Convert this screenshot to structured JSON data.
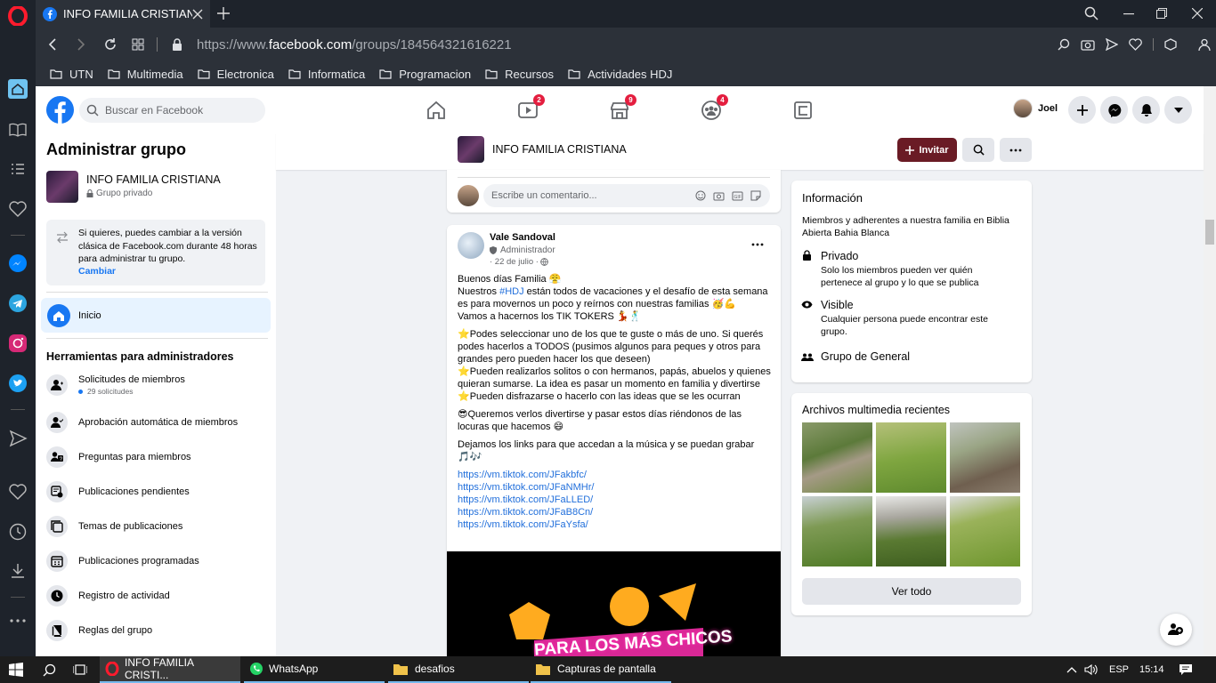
{
  "browser": {
    "tab_title": "INFO FAMILIA CRISTIANA |",
    "url_prefix": "https://www.",
    "url_domain": "facebook.com",
    "url_path": "/groups/184564321616221",
    "bookmarks": [
      "UTN",
      "Multimedia",
      "Electronica",
      "Informatica",
      "Programacion",
      "Recursos",
      "Actividades HDJ"
    ]
  },
  "fb_header": {
    "search_placeholder": "Buscar en Facebook",
    "badges": {
      "watch": "2",
      "marketplace": "9",
      "groups": "4"
    },
    "user_name": "Joel"
  },
  "left_panel": {
    "title": "Administrar grupo",
    "group_name": "INFO FAMILIA CRISTIANA",
    "privacy": "Grupo privado",
    "notice": "Si quieres, puedes cambiar a la versión clásica de Facebook.com durante 48 horas para administrar tu grupo.",
    "notice_link": "Cambiar",
    "home": "Inicio",
    "tools_title": "Herramientas para administradores",
    "tools": [
      {
        "label": "Solicitudes de miembros",
        "sub": "29 solicitudes"
      },
      {
        "label": "Aprobación automática de miembros"
      },
      {
        "label": "Preguntas para miembros"
      },
      {
        "label": "Publicaciones pendientes"
      },
      {
        "label": "Temas de publicaciones"
      },
      {
        "label": "Publicaciones programadas"
      },
      {
        "label": "Registro de actividad"
      },
      {
        "label": "Reglas del grupo"
      }
    ]
  },
  "group_header": {
    "name": "INFO FAMILIA CRISTIANA",
    "invite": "Invitar"
  },
  "comment_placeholder": "Escribe un comentario...",
  "post": {
    "author": "Vale Sandoval",
    "role": "Administrador",
    "date": "· 22 de julio ·",
    "p1": "Buenos días Familia 😤",
    "p2a": "Nuestros ",
    "hashtag": "#HDJ",
    "p2b": " están todos de vacaciones y el desafío de esta semana es para movernos un poco y reírnos con nuestras familias 🥳💪",
    "p3": "Vamos a hacernos los TIK TOKERS 💃🕺",
    "p4": "⭐Podes seleccionar uno de los que te guste o más de uno. Si querés podes hacerlos a TODOS (pusimos algunos para peques y otros para grandes pero pueden hacer los que deseen)",
    "p5": "⭐Pueden realizarlos solitos o con hermanos, papás, abuelos y quienes quieran sumarse. La idea es pasar un momento en familia y divertirse",
    "p6": "⭐Pueden disfrazarse o hacerlo con las ideas que se les ocurran",
    "p7": "😎Queremos verlos divertirse y pasar estos días riéndonos de las locuras que hacemos 😄",
    "p8": "Dejamos los links para que accedan a la música y se puedan grabar 🎵🎶",
    "links": [
      "https://vm.tiktok.com/JFakbfc/",
      "https://vm.tiktok.com/JFaNMHr/",
      "https://vm.tiktok.com/JFaLLED/",
      "https://vm.tiktok.com/JFaB8Cn/",
      "https://vm.tiktok.com/JFaYsfa/"
    ],
    "image_text": "PARA LOS MÁS CHICOS"
  },
  "info_card": {
    "title": "Información",
    "description": "Miembros y adherentes a nuestra familia en Biblia Abierta Bahia Blanca",
    "private_title": "Privado",
    "private_desc": "Solo los miembros pueden ver quién pertenece al grupo y lo que se publica",
    "visible_title": "Visible",
    "visible_desc": "Cualquier persona puede encontrar este grupo.",
    "category": "Grupo de General"
  },
  "media_card": {
    "title": "Archivos multimedia recientes",
    "button": "Ver todo"
  },
  "taskbar": {
    "items": [
      "INFO FAMILIA CRISTI...",
      "WhatsApp",
      "desafios",
      "Capturas de pantalla"
    ],
    "lang": "ESP",
    "time": "15:14"
  },
  "colors": {
    "fb_blue": "#1877f2",
    "invite_bg": "#6a1b25",
    "link": "#216fdb",
    "badge": "#e41e3f"
  }
}
